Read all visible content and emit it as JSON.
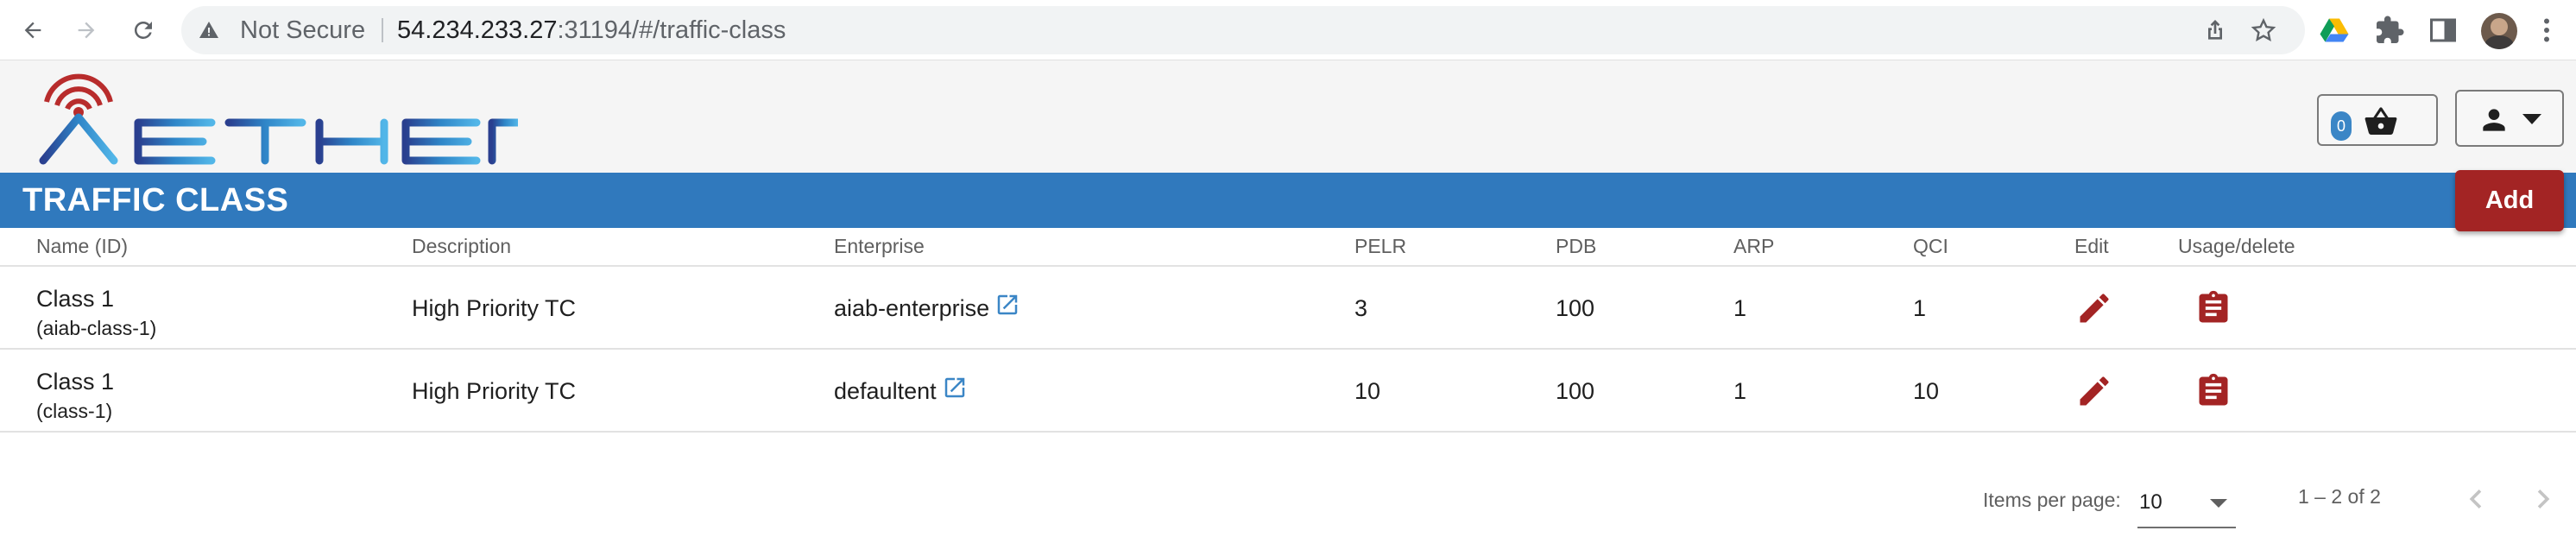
{
  "browser": {
    "security_status": "Not Secure",
    "url_host": "54.234.233.27",
    "url_rest": ":31194/#/traffic-class"
  },
  "header": {
    "logo_text": "AETHER",
    "basket_count": "0"
  },
  "page": {
    "title": "TRAFFIC CLASS",
    "add_label": "Add"
  },
  "table": {
    "columns": [
      "Name (ID)",
      "Description",
      "Enterprise",
      "PELR",
      "PDB",
      "ARP",
      "QCI",
      "Edit",
      "Usage/delete"
    ],
    "rows": [
      {
        "name": "Class 1",
        "id": "(aiab-class-1)",
        "description": "High Priority TC",
        "enterprise": "aiab-enterprise",
        "pelr": "3",
        "pdb": "100",
        "arp": "1",
        "qci": "1"
      },
      {
        "name": "Class 1",
        "id": "(class-1)",
        "description": "High Priority TC",
        "enterprise": "defaultent",
        "pelr": "10",
        "pdb": "100",
        "arp": "1",
        "qci": "10"
      }
    ]
  },
  "paginator": {
    "items_label": "Items per page:",
    "page_size": "10",
    "range": "1 – 2 of 2"
  },
  "colors": {
    "title_bar": "#3079bd",
    "accent_red": "#a32424",
    "link_blue": "#3b86c6"
  }
}
